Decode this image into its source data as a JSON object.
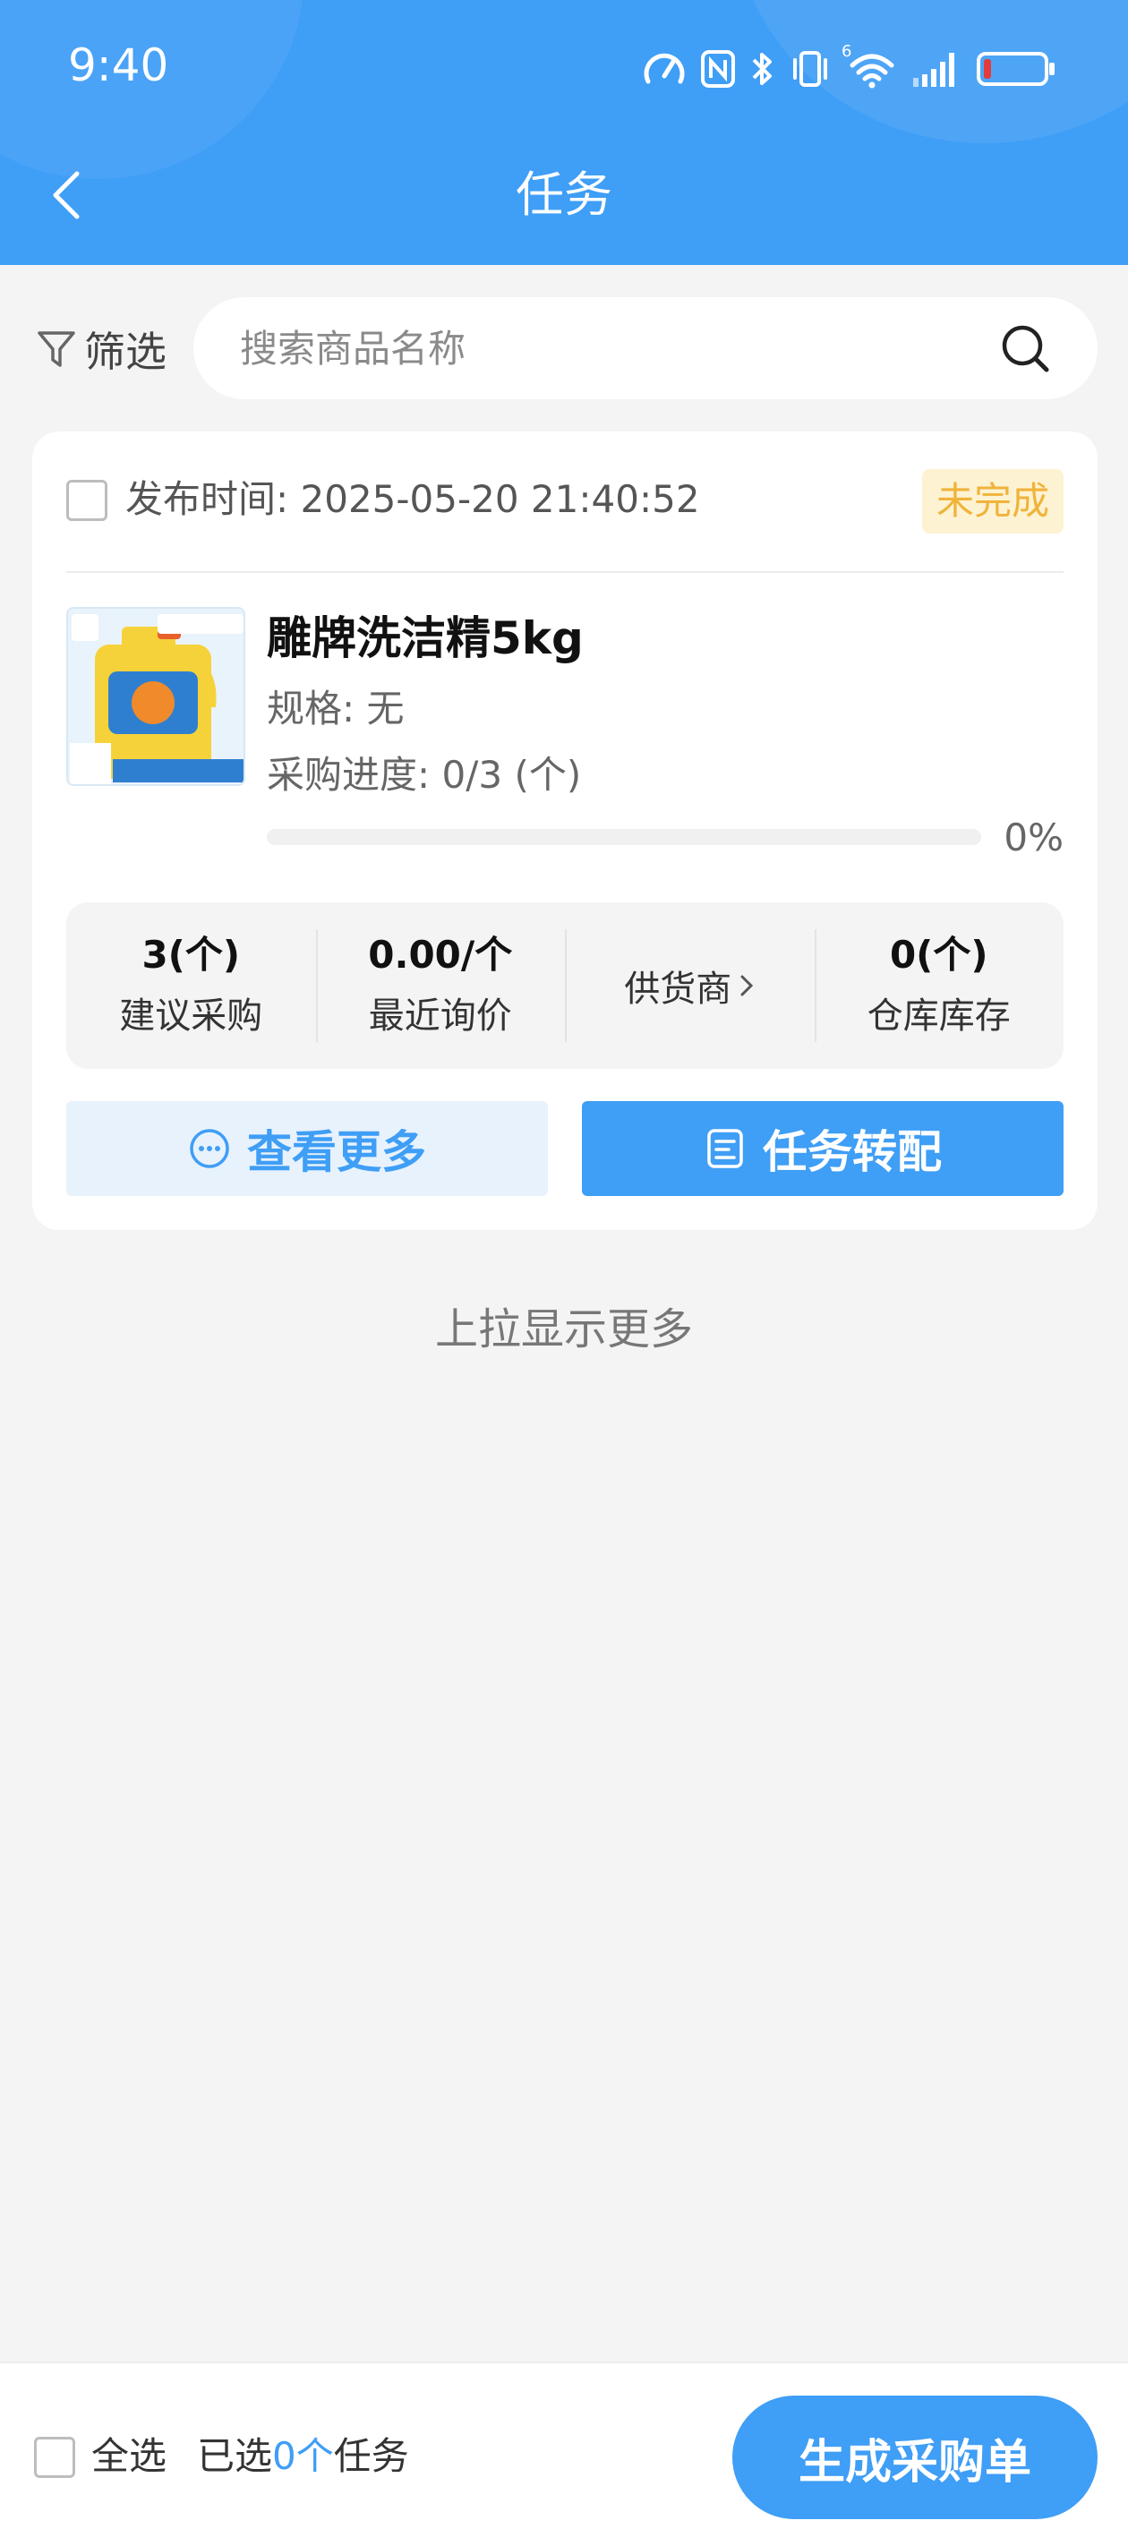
{
  "status_bar": {
    "time": "9:40",
    "icons": [
      "speed-icon",
      "nfc-icon",
      "bluetooth-icon",
      "vibrate-icon",
      "wifi-icon",
      "signal-icon",
      "battery-icon"
    ],
    "wifi_badge": "6",
    "battery_level": 0.08
  },
  "header": {
    "title": "任务",
    "back_icon": "chevron-left-icon"
  },
  "filter": {
    "label": "筛选",
    "icon": "filter-icon"
  },
  "search": {
    "placeholder": "搜索商品名称",
    "value": "",
    "icon": "search-icon"
  },
  "task": {
    "publish_time": "发布时间: 2025-05-20 21:40:52",
    "status": "未完成",
    "product_name": "雕牌洗洁精5kg",
    "spec": "规格: 无",
    "progress_text": "采购进度: 0/3 (个)",
    "progress_value": 0,
    "progress_percent": "0%",
    "stats": {
      "suggested_value": "3(个)",
      "suggested_label": "建议采购",
      "recent_price_value": "0.00/个",
      "recent_price_label": "最近询价",
      "supplier_label": "供货商",
      "stock_value": "0(个)",
      "stock_label": "仓库库存"
    },
    "view_more_label": "查看更多",
    "reassign_label": "任务转配"
  },
  "list": {
    "load_more": "上拉显示更多"
  },
  "bottom": {
    "select_all": "全选",
    "selected_prefix": "已选",
    "selected_count": "0个",
    "selected_suffix": "任务",
    "generate_label": "生成采购单"
  },
  "colors": {
    "primary": "#3f9ef6",
    "badge_bg": "#fdf2d2",
    "badge_text": "#f0b33a",
    "battery_low": "#e23b3b"
  }
}
